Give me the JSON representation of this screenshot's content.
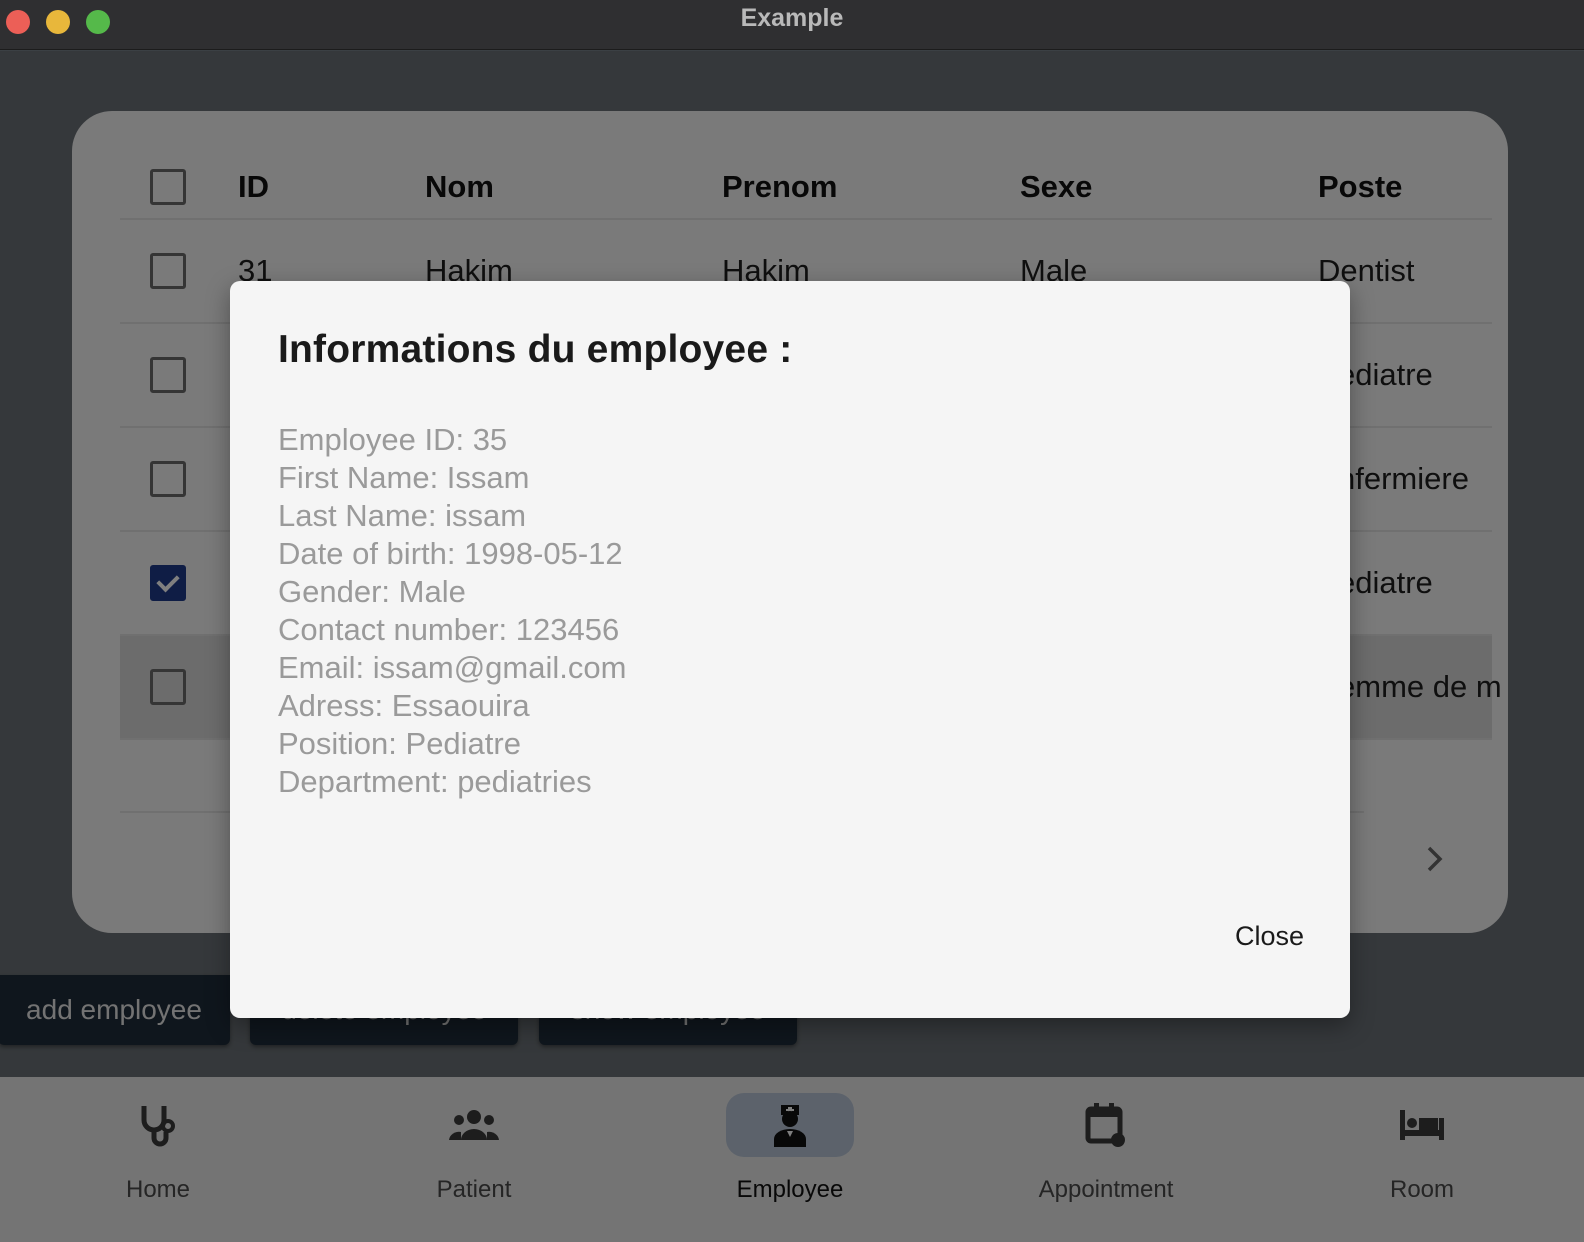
{
  "window": {
    "title": "Example"
  },
  "table": {
    "headers": {
      "id": "ID",
      "nom": "Nom",
      "prenom": "Prenom",
      "sexe": "Sexe",
      "poste": "Poste"
    },
    "rows": [
      {
        "id": "31",
        "nom": "Hakim",
        "prenom": "Hakim",
        "sexe": "Male",
        "poste": "Dentist",
        "checked": false
      },
      {
        "id": "",
        "nom": "",
        "prenom": "",
        "sexe": "",
        "poste": "ediatre",
        "checked": false
      },
      {
        "id": "",
        "nom": "",
        "prenom": "",
        "sexe": "",
        "poste": "nfermiere",
        "checked": false
      },
      {
        "id": "",
        "nom": "",
        "prenom": "",
        "sexe": "",
        "poste": "ediatre",
        "checked": true
      },
      {
        "id": "",
        "nom": "",
        "prenom": "",
        "sexe": "",
        "poste": "emme de m",
        "checked": false
      }
    ]
  },
  "actions": {
    "add": "add employee",
    "delete": "delete employee",
    "show": "show employee"
  },
  "nav": [
    {
      "label": "Home",
      "icon": "stethoscope-icon",
      "active": false
    },
    {
      "label": "Patient",
      "icon": "people-icon",
      "active": false
    },
    {
      "label": "Employee",
      "icon": "doctor-icon",
      "active": true
    },
    {
      "label": "Appointment",
      "icon": "calendar-icon",
      "active": false
    },
    {
      "label": "Room",
      "icon": "bed-icon",
      "active": false
    }
  ],
  "dialog": {
    "title": "Informations du employee :",
    "lines": [
      "Employee ID: 35",
      "First Name: Issam",
      "Last Name: issam",
      "Date of birth: 1998-05-12",
      "Gender: Male",
      "Contact number: 123456",
      "Email: issam@gmail.com",
      "Adress: Essaouira",
      "Position: Pediatre",
      "Department: pediatries"
    ],
    "close_label": "Close"
  },
  "colors": {
    "accent": "#1e3a8a",
    "nav_active": "#b8c5d6",
    "action_button": "#1f2d3a"
  }
}
